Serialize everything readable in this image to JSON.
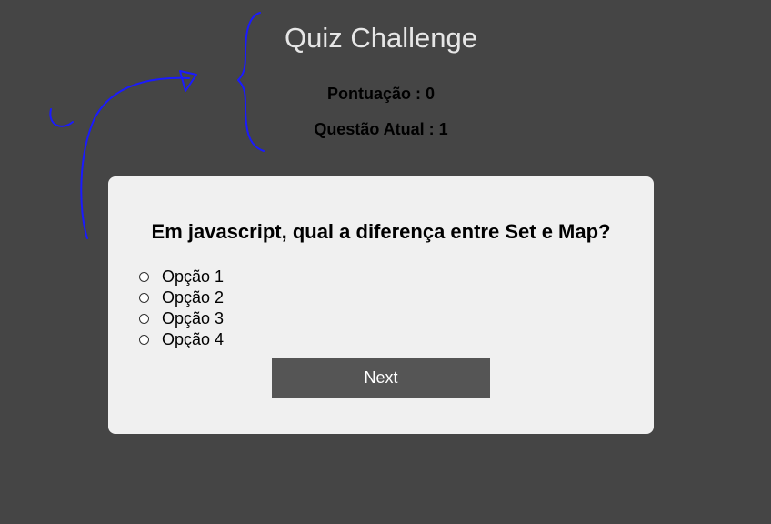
{
  "header": {
    "title": "Quiz Challenge",
    "score_text": "Pontuação : 0",
    "current_question_text": "Questão Atual : 1"
  },
  "quiz": {
    "question": "Em javascript, qual a diferença entre Set e Map?",
    "options": [
      {
        "label": "Opção 1"
      },
      {
        "label": "Opção 2"
      },
      {
        "label": "Opção 3"
      },
      {
        "label": "Opção 4"
      }
    ],
    "next_label": "Next"
  },
  "colors": {
    "background": "#454545",
    "card": "#f0f0f0",
    "button": "#555555",
    "annotation": "#1a1aff"
  }
}
